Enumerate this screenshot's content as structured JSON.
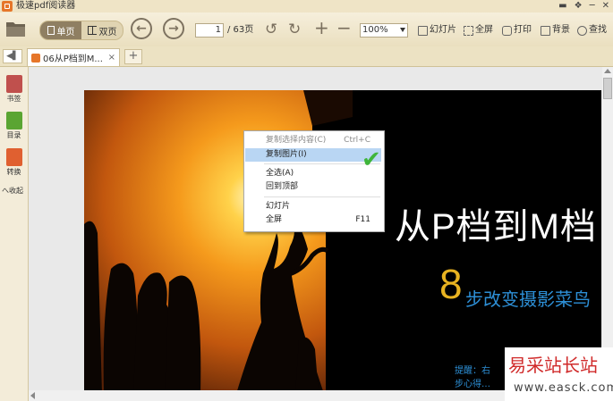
{
  "window": {
    "title": "极速pdf阅读器",
    "controls": [
      "▬",
      "❖",
      "─",
      "✕"
    ]
  },
  "toolbar": {
    "single_page_label": "单页",
    "double_page_label": "双页",
    "current_page": "1",
    "total_pages": "/ 63页",
    "zoom": "100%",
    "slideshow_label": "幻灯片",
    "fullscreen_label": "全屏",
    "print_label": "打印",
    "background_label": "背景",
    "find_label": "查找"
  },
  "tabs": {
    "active_title": "06从P档到M...",
    "close_glyph": "×",
    "add_glyph": "+",
    "collapse_glyph": "◀▌"
  },
  "sidebar": {
    "items": [
      {
        "label": "书签",
        "icon": "bookmark-icon",
        "color": "#c0504d"
      },
      {
        "label": "目录",
        "icon": "toc-icon",
        "color": "#5aa532"
      },
      {
        "label": "转换",
        "icon": "convert-icon",
        "color": "#e06030"
      }
    ],
    "collapse_label": "へ收起"
  },
  "page": {
    "title": "从P档到M档",
    "number": "8",
    "subtitle": "步改变摄影菜鸟",
    "tip_line1": "提醒：右",
    "tip_line2": "步心得…"
  },
  "context_menu": {
    "items": [
      {
        "label": "复制选择内容(C)",
        "shortcut": "Ctrl+C",
        "state": "disabled"
      },
      {
        "label": "复制图片(I)",
        "shortcut": "",
        "state": "hover"
      },
      {
        "label": "全选(A)",
        "shortcut": "",
        "state": "normal"
      },
      {
        "label": "回到顶部",
        "shortcut": "",
        "state": "normal"
      },
      {
        "label": "幻灯片",
        "shortcut": "",
        "state": "normal"
      },
      {
        "label": "全屏",
        "shortcut": "F11",
        "state": "normal"
      }
    ],
    "check_glyph": "✔"
  },
  "watermark": {
    "title": "易采站长站",
    "url": "www.easck.com"
  },
  "colors": {
    "accent_orange": "#e6762a",
    "menu_highlight": "#b9d6f3",
    "page_number_gold": "#e8b321",
    "subtitle_blue": "#2d8fd6"
  }
}
